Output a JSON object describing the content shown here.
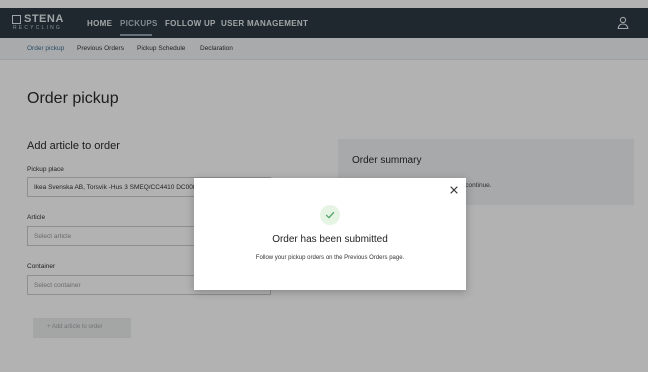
{
  "logo": {
    "main": "STENA",
    "sub": "RECYCLING"
  },
  "topnav": {
    "items": [
      {
        "label": "HOME",
        "active": false
      },
      {
        "label": "PICKUPS",
        "active": true
      },
      {
        "label": "FOLLOW UP",
        "active": false
      },
      {
        "label": "USER MANAGEMENT",
        "active": false
      }
    ],
    "user_icon": "user-icon"
  },
  "subnav": {
    "items": [
      {
        "label": "Order pickup",
        "active": true
      },
      {
        "label": "Previous Orders",
        "active": false
      },
      {
        "label": "Pickup Schedule",
        "active": false
      },
      {
        "label": "Declaration",
        "active": false
      }
    ]
  },
  "main": {
    "title": "Order pickup",
    "section_title": "Add article to order",
    "pickup_place": {
      "label": "Pickup place",
      "value": "Ikea Svenska AB, Torsvik -Hus 3 SMEQ/CC4410 DC008"
    },
    "article": {
      "label": "Article",
      "placeholder": "Select article"
    },
    "container": {
      "label": "Container",
      "placeholder": "Select container"
    },
    "add_button": "+ Add article to order"
  },
  "summary": {
    "title": "Order summary",
    "text": "to continue."
  },
  "modal": {
    "title": "Order has been submitted",
    "message": "Follow your pickup orders on the Previous Orders page.",
    "close_icon": "close-icon",
    "success_icon": "check-icon"
  },
  "colors": {
    "nav_background": "#2b3a43",
    "accent": "#3d6f93",
    "success": "#4fa36a"
  }
}
